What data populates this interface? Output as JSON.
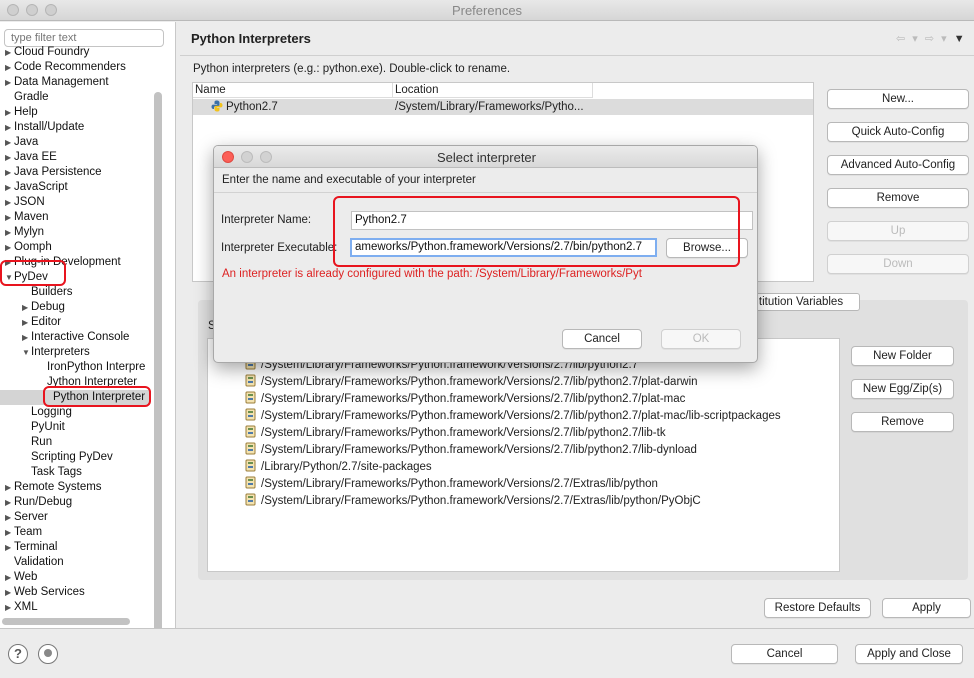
{
  "window": {
    "title": "Preferences"
  },
  "sidebar": {
    "filter_placeholder": "type filter text",
    "items": [
      {
        "label": "Cloud Foundry",
        "level": 1,
        "arrow": "▶"
      },
      {
        "label": "Code Recommenders",
        "level": 1,
        "arrow": "▶"
      },
      {
        "label": "Data Management",
        "level": 1,
        "arrow": "▶"
      },
      {
        "label": "Gradle",
        "level": 1,
        "arrow": ""
      },
      {
        "label": "Help",
        "level": 1,
        "arrow": "▶"
      },
      {
        "label": "Install/Update",
        "level": 1,
        "arrow": "▶"
      },
      {
        "label": "Java",
        "level": 1,
        "arrow": "▶"
      },
      {
        "label": "Java EE",
        "level": 1,
        "arrow": "▶"
      },
      {
        "label": "Java Persistence",
        "level": 1,
        "arrow": "▶"
      },
      {
        "label": "JavaScript",
        "level": 1,
        "arrow": "▶"
      },
      {
        "label": "JSON",
        "level": 1,
        "arrow": "▶"
      },
      {
        "label": "Maven",
        "level": 1,
        "arrow": "▶"
      },
      {
        "label": "Mylyn",
        "level": 1,
        "arrow": "▶"
      },
      {
        "label": "Oomph",
        "level": 1,
        "arrow": "▶"
      },
      {
        "label": "Plug-in Development",
        "level": 1,
        "arrow": "▶"
      },
      {
        "label": "PyDev",
        "level": 1,
        "arrow": "▼"
      },
      {
        "label": "Builders",
        "level": 2,
        "arrow": ""
      },
      {
        "label": "Debug",
        "level": 2,
        "arrow": "▶"
      },
      {
        "label": "Editor",
        "level": 2,
        "arrow": "▶"
      },
      {
        "label": "Interactive Console",
        "level": 2,
        "arrow": "▶"
      },
      {
        "label": "Interpreters",
        "level": 2,
        "arrow": "▼"
      },
      {
        "label": "IronPython Interpre",
        "level": 3,
        "arrow": ""
      },
      {
        "label": "Jython Interpreter",
        "level": 3,
        "arrow": ""
      },
      {
        "label": "Python Interpreter",
        "level": 3,
        "arrow": "",
        "selected": true
      },
      {
        "label": "Logging",
        "level": 2,
        "arrow": ""
      },
      {
        "label": "PyUnit",
        "level": 2,
        "arrow": ""
      },
      {
        "label": "Run",
        "level": 2,
        "arrow": ""
      },
      {
        "label": "Scripting PyDev",
        "level": 2,
        "arrow": ""
      },
      {
        "label": "Task Tags",
        "level": 2,
        "arrow": ""
      },
      {
        "label": "Remote Systems",
        "level": 1,
        "arrow": "▶"
      },
      {
        "label": "Run/Debug",
        "level": 1,
        "arrow": "▶"
      },
      {
        "label": "Server",
        "level": 1,
        "arrow": "▶"
      },
      {
        "label": "Team",
        "level": 1,
        "arrow": "▶"
      },
      {
        "label": "Terminal",
        "level": 1,
        "arrow": "▶"
      },
      {
        "label": "Validation",
        "level": 1,
        "arrow": ""
      },
      {
        "label": "Web",
        "level": 1,
        "arrow": "▶"
      },
      {
        "label": "Web Services",
        "level": 1,
        "arrow": "▶"
      },
      {
        "label": "XML",
        "level": 1,
        "arrow": "▶"
      }
    ]
  },
  "main": {
    "title": "Python Interpreters",
    "nav": {
      "back": "⇦ ▾",
      "forward": "⇨ ▾",
      "menu": "▼"
    },
    "hint": "Python interpreters (e.g.: python.exe).   Double-click to rename.",
    "table": {
      "columns": [
        "Name",
        "Location"
      ],
      "rows": [
        {
          "name": "Python2.7",
          "location": "/System/Library/Frameworks/Pytho..."
        }
      ]
    },
    "buttons": {
      "new": "New...",
      "quick": "Quick Auto-Config",
      "advanced": "Advanced Auto-Config",
      "remove": "Remove",
      "up": "Up",
      "down": "Down"
    },
    "tab_visible": "titution Variables",
    "lib_label": "S",
    "libraries": [
      "/System/Library/Frameworks/Python.framework/Versions/2.7/lib/python2.7",
      "/System/Library/Frameworks/Python.framework/Versions/2.7/lib/python2.7/plat-darwin",
      "/System/Library/Frameworks/Python.framework/Versions/2.7/lib/python2.7/plat-mac",
      "/System/Library/Frameworks/Python.framework/Versions/2.7/lib/python2.7/plat-mac/lib-scriptpackages",
      "/System/Library/Frameworks/Python.framework/Versions/2.7/lib/python2.7/lib-tk",
      "/System/Library/Frameworks/Python.framework/Versions/2.7/lib/python2.7/lib-dynload",
      "/Library/Python/2.7/site-packages",
      "/System/Library/Frameworks/Python.framework/Versions/2.7/Extras/lib/python",
      "/System/Library/Frameworks/Python.framework/Versions/2.7/Extras/lib/python/PyObjC"
    ],
    "lib_buttons": {
      "new_folder": "New Folder",
      "new_egg": "New Egg/Zip(s)",
      "remove": "Remove"
    },
    "restore_defaults": "Restore Defaults",
    "apply": "Apply"
  },
  "footer": {
    "help": "?",
    "cancel": "Cancel",
    "apply_close": "Apply and Close"
  },
  "dialog": {
    "title": "Select interpreter",
    "intro": "Enter the name and executable of your interpreter",
    "name_label": "Interpreter Name:",
    "name_value": "Python2.7",
    "exe_label": "Interpreter Executable:",
    "exe_value": "ameworks/Python.framework/Versions/2.7/bin/python2.7",
    "browse": "Browse...",
    "error": "An interpreter is already configured with the path: /System/Library/Frameworks/Pyt",
    "cancel": "Cancel",
    "ok": "OK"
  },
  "colors": {
    "annotation": "#e8141e",
    "error": "#dd2222",
    "focus": "#7eaef0"
  },
  "icons": {
    "interpreter": "python-logo-icon",
    "library": "jar-file-icon"
  }
}
